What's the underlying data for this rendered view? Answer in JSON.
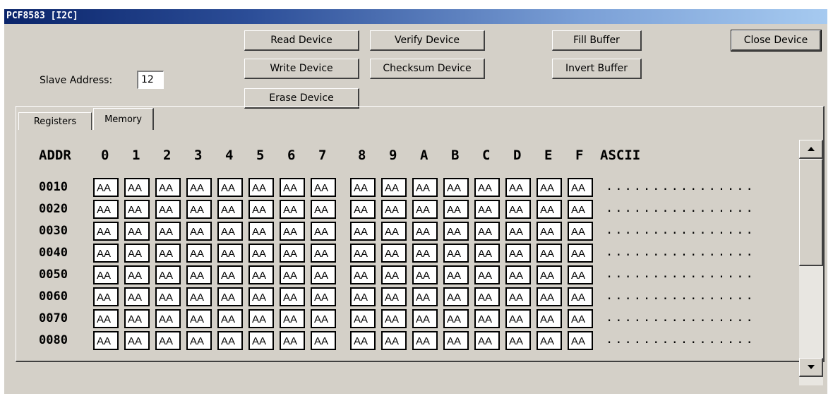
{
  "window": {
    "title": "PCF8583 [I2C]"
  },
  "buttons": {
    "read": "Read Device",
    "write": "Write Device",
    "erase": "Erase Device",
    "verify": "Verify Device",
    "checksum": "Checksum Device",
    "fill": "Fill Buffer",
    "invert": "Invert Buffer",
    "close": "Close Device"
  },
  "slave": {
    "label": "Slave Address:",
    "value": "12"
  },
  "tabs": [
    {
      "label": "Registers"
    },
    {
      "label": "Memory",
      "selected": true
    }
  ],
  "memory": {
    "header": {
      "addr": "ADDR",
      "cols": [
        "0",
        "1",
        "2",
        "3",
        "4",
        "5",
        "6",
        "7",
        "8",
        "9",
        "A",
        "B",
        "C",
        "D",
        "E",
        "F"
      ],
      "ascii": "ASCII"
    },
    "rows": [
      {
        "addr": "0010",
        "bytes": [
          "AA",
          "AA",
          "AA",
          "AA",
          "AA",
          "AA",
          "AA",
          "AA",
          "AA",
          "AA",
          "AA",
          "AA",
          "AA",
          "AA",
          "AA",
          "AA"
        ],
        "ascii": "................"
      },
      {
        "addr": "0020",
        "bytes": [
          "AA",
          "AA",
          "AA",
          "AA",
          "AA",
          "AA",
          "AA",
          "AA",
          "AA",
          "AA",
          "AA",
          "AA",
          "AA",
          "AA",
          "AA",
          "AA"
        ],
        "ascii": "................"
      },
      {
        "addr": "0030",
        "bytes": [
          "AA",
          "AA",
          "AA",
          "AA",
          "AA",
          "AA",
          "AA",
          "AA",
          "AA",
          "AA",
          "AA",
          "AA",
          "AA",
          "AA",
          "AA",
          "AA"
        ],
        "ascii": "................"
      },
      {
        "addr": "0040",
        "bytes": [
          "AA",
          "AA",
          "AA",
          "AA",
          "AA",
          "AA",
          "AA",
          "AA",
          "AA",
          "AA",
          "AA",
          "AA",
          "AA",
          "AA",
          "AA",
          "AA"
        ],
        "ascii": "................"
      },
      {
        "addr": "0050",
        "bytes": [
          "AA",
          "AA",
          "AA",
          "AA",
          "AA",
          "AA",
          "AA",
          "AA",
          "AA",
          "AA",
          "AA",
          "AA",
          "AA",
          "AA",
          "AA",
          "AA"
        ],
        "ascii": "................"
      },
      {
        "addr": "0060",
        "bytes": [
          "AA",
          "AA",
          "AA",
          "AA",
          "AA",
          "AA",
          "AA",
          "AA",
          "AA",
          "AA",
          "AA",
          "AA",
          "AA",
          "AA",
          "AA",
          "AA"
        ],
        "ascii": "................"
      },
      {
        "addr": "0070",
        "bytes": [
          "AA",
          "AA",
          "AA",
          "AA",
          "AA",
          "AA",
          "AA",
          "AA",
          "AA",
          "AA",
          "AA",
          "AA",
          "AA",
          "AA",
          "AA",
          "AA"
        ],
        "ascii": "................"
      },
      {
        "addr": "0080",
        "bytes": [
          "AA",
          "AA",
          "AA",
          "AA",
          "AA",
          "AA",
          "AA",
          "AA",
          "AA",
          "AA",
          "AA",
          "AA",
          "AA",
          "AA",
          "AA",
          "AA"
        ],
        "ascii": "................"
      }
    ]
  },
  "scrollbar": {
    "up_icon": "arrow-up-icon",
    "down_icon": "arrow-down-icon"
  }
}
